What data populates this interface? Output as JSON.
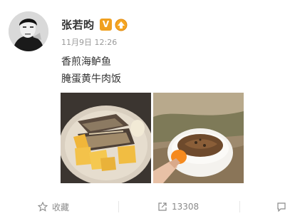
{
  "post": {
    "author": {
      "name": "张若昀",
      "vip_badge": "V"
    },
    "meta": {
      "date": "11月9日",
      "time": "12:26"
    },
    "text_lines": [
      "香煎海鲈鱼",
      "腌蛋黄牛肉饭"
    ],
    "photos": [
      {
        "alt": "pan-fried sea bass with potatoes"
      },
      {
        "alt": "egg yolk beef rice bowl"
      }
    ]
  },
  "actions": {
    "favorite_label": "收藏",
    "repost_count": "13308"
  },
  "colors": {
    "accent": "#f0a020",
    "text": "#333333",
    "muted": "#9a9a9a"
  }
}
